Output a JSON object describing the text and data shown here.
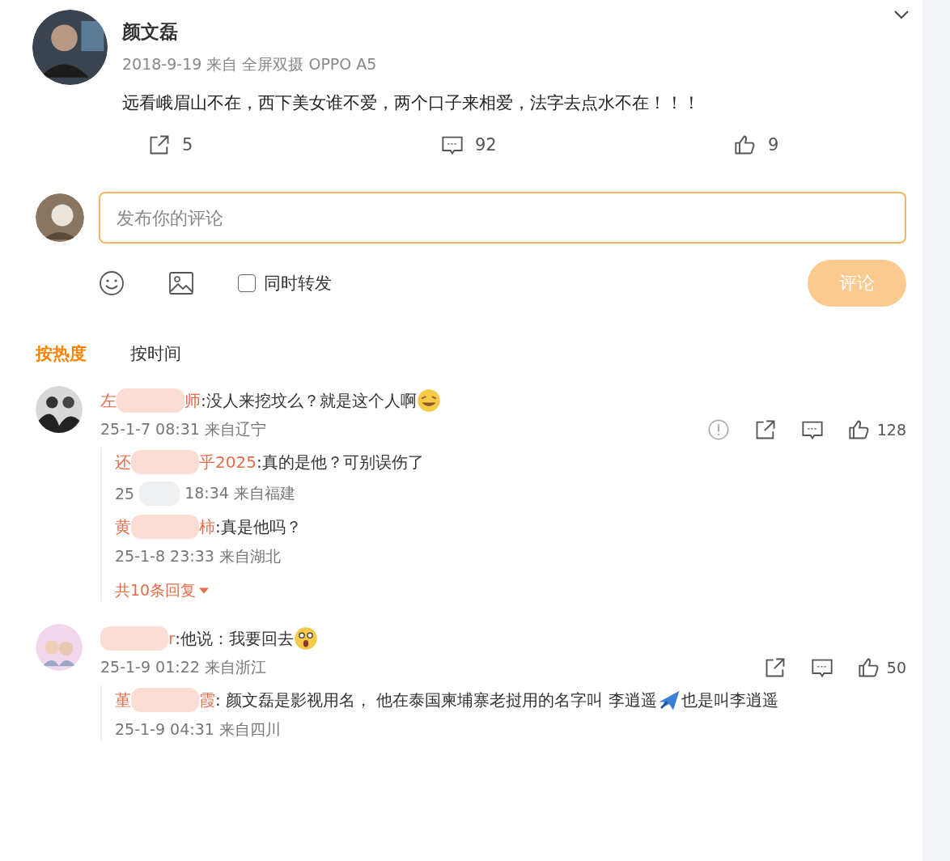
{
  "post": {
    "author": "颜文磊",
    "meta": "2018-9-19 来自 全屏双摄 OPPO A5",
    "text": "远看峨眉山不在，西下美女谁不爱，两个口子来相爱，法字去点水不在！！！",
    "actions": [
      {
        "kind": "share",
        "count": "5"
      },
      {
        "kind": "comment",
        "count": "92"
      },
      {
        "kind": "like",
        "count": "9"
      }
    ]
  },
  "composer": {
    "placeholder": "发布你的评论",
    "repost_label": "同时转发",
    "repost_checked": false,
    "submit": "评论",
    "submit_disabled": true
  },
  "sort_tabs": [
    {
      "label": "按热度",
      "selected": true
    },
    {
      "label": "按时间",
      "selected": false
    }
  ],
  "comments": [
    {
      "name_start": "左",
      "name_end": "师",
      "text": ":没人来挖坟么？就是这个人啊",
      "emoji": {
        "kind": "laugh"
      },
      "time": "25-1-7 08:31 来自辽宁",
      "actions": [
        {
          "kind": "report"
        },
        {
          "kind": "share"
        },
        {
          "kind": "comment"
        },
        {
          "kind": "like",
          "count": "128"
        }
      ],
      "replies": [
        {
          "name_start": "还",
          "name_end": "乎2025",
          "text": ":真的是他？可别误伤了",
          "time_start": "25",
          "time_end": "18:34 来自福建"
        },
        {
          "name_start": "黄",
          "name_end": "柿",
          "text": ":真是他吗？",
          "time_end": "25-1-8 23:33 来自湖北"
        }
      ],
      "more": "共10条回复"
    },
    {
      "name_end": "r",
      "text": ":他说：我要回去",
      "emoji": {
        "kind": "shock"
      },
      "time": "25-1-9 01:22 来自浙江",
      "actions": [
        {
          "kind": "share"
        },
        {
          "kind": "comment"
        },
        {
          "kind": "like",
          "count": "50"
        }
      ],
      "replies": [
        {
          "name_start": "堇",
          "name_end": "霞",
          "text": ": 颜文磊是影视用名， 他在泰国柬埔寨老挝用的名字叫 李逍遥 ",
          "emoji": {
            "kind": "plane"
          },
          "text_after": "也是叫李逍遥",
          "time_end": "25-1-9 04:31 来自四川"
        }
      ]
    }
  ]
}
